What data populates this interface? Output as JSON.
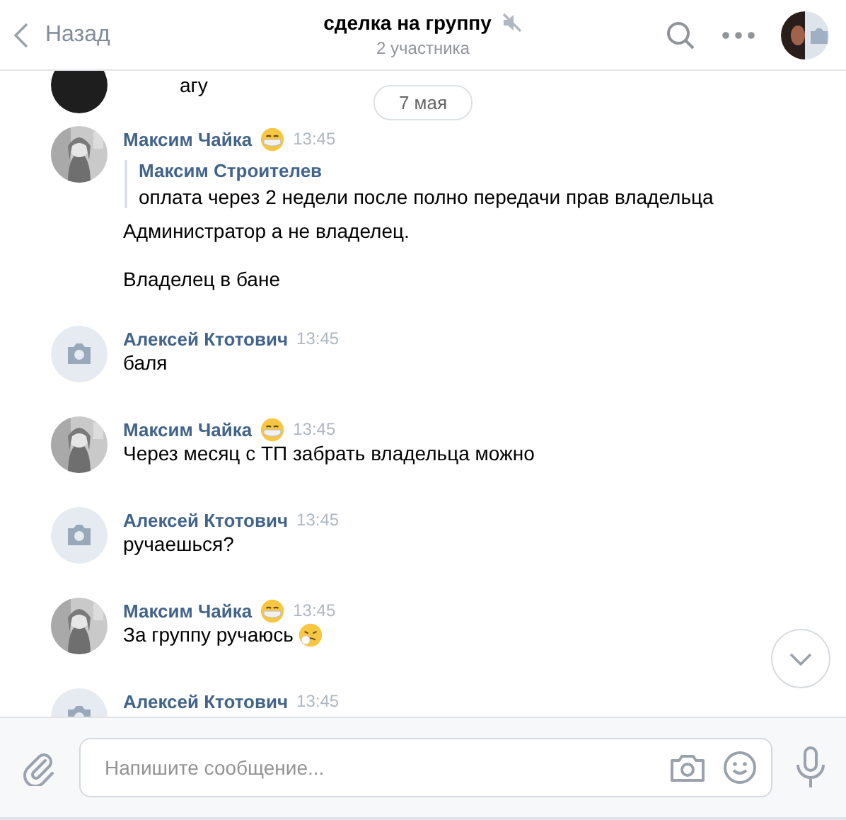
{
  "header": {
    "back_label": "Назад",
    "title": "сделка на группу",
    "muted": true,
    "subtitle": "2 участника"
  },
  "partial_message": {
    "text": "агу"
  },
  "date_divider": "7 мая",
  "messages": [
    {
      "author": "Максим Чайка",
      "status_emoji": true,
      "time": "13:45",
      "quote": {
        "author": "Максим Строителев",
        "text": "оплата через 2 недели после полно передачи прав владельца"
      },
      "text": "Администратор а не владелец.\n\nВладелец в бане",
      "trailing_emoji": false
    },
    {
      "author": "Алексей Ктотович",
      "status_emoji": false,
      "avatar": {
        "kind": "camera"
      },
      "time": "13:45",
      "text": "баля",
      "trailing_emoji": false
    },
    {
      "author": "Максим Чайка",
      "status_emoji": true,
      "time": "13:45",
      "text": "Через месяц с ТП забрать владельца можно",
      "trailing_emoji": false
    },
    {
      "author": "Алексей Ктотович",
      "status_emoji": false,
      "avatar": {
        "kind": "camera"
      },
      "time": "13:45",
      "text": "ручаешься?",
      "trailing_emoji": false
    },
    {
      "author": "Максим Чайка",
      "status_emoji": true,
      "time": "13:45",
      "text": "За группу ручаюсь",
      "trailing_emoji": true
    },
    {
      "author": "Алексей Ктотович",
      "status_emoji": false,
      "avatar": {
        "kind": "camera"
      },
      "time": "13:45",
      "trailing_emoji": false
    }
  ],
  "composer": {
    "placeholder": "Напишите сообщение..."
  }
}
